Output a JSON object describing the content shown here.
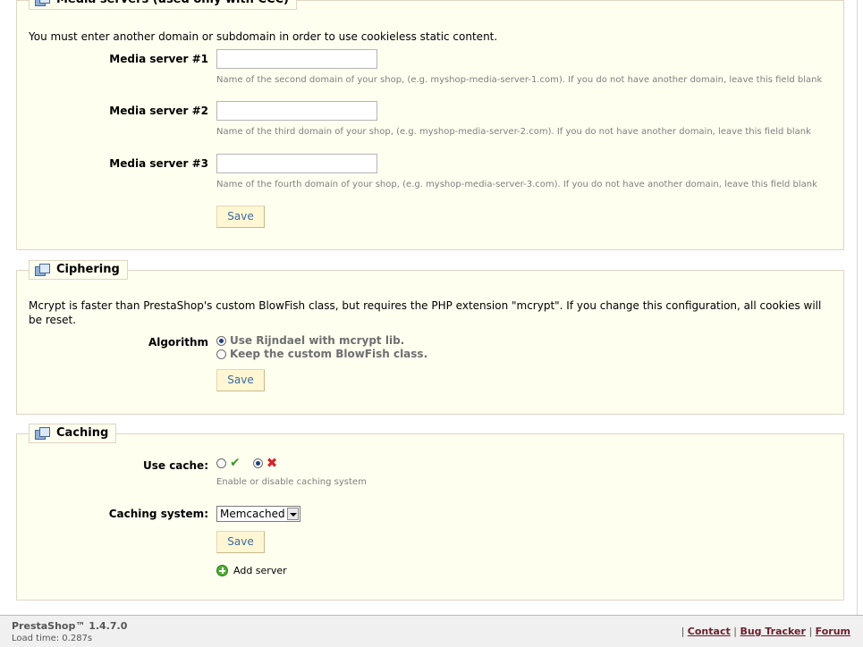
{
  "media_servers": {
    "legend": "Media servers (used only with CCC)",
    "intro": "You must enter another domain or subdomain in order to use cookieless static content.",
    "servers": [
      {
        "label": "Media server #1",
        "value": "",
        "hint": "Name of the second domain of your shop, (e.g. myshop-media-server-1.com). If you do not have another domain, leave this field blank"
      },
      {
        "label": "Media server #2",
        "value": "",
        "hint": "Name of the third domain of your shop, (e.g. myshop-media-server-2.com). If you do not have another domain, leave this field blank"
      },
      {
        "label": "Media server #3",
        "value": "",
        "hint": "Name of the fourth domain of your shop, (e.g. myshop-media-server-3.com). If you do not have another domain, leave this field blank"
      }
    ],
    "save_label": "Save"
  },
  "ciphering": {
    "legend": "Ciphering",
    "intro": "Mcrypt is faster than PrestaShop's custom BlowFish class, but requires the PHP extension \"mcrypt\". If you change this configuration, all cookies will be reset.",
    "algorithm_label": "Algorithm",
    "options": [
      {
        "label": "Use Rijndael with mcrypt lib.",
        "selected": true
      },
      {
        "label": "Keep the custom BlowFish class.",
        "selected": false
      }
    ],
    "save_label": "Save"
  },
  "caching": {
    "legend": "Caching",
    "use_cache_label": "Use cache:",
    "use_cache_value": "no",
    "use_cache_hint": "Enable or disable caching system",
    "system_label": "Caching system:",
    "system_value": "Memcached",
    "save_label": "Save",
    "add_server_label": "Add server"
  },
  "footer": {
    "version": "PrestaShop™ 1.4.7.0",
    "load_time": "Load time: 0.287s",
    "separator": "|",
    "links": [
      "Contact",
      "Bug Tracker",
      "Forum"
    ]
  }
}
